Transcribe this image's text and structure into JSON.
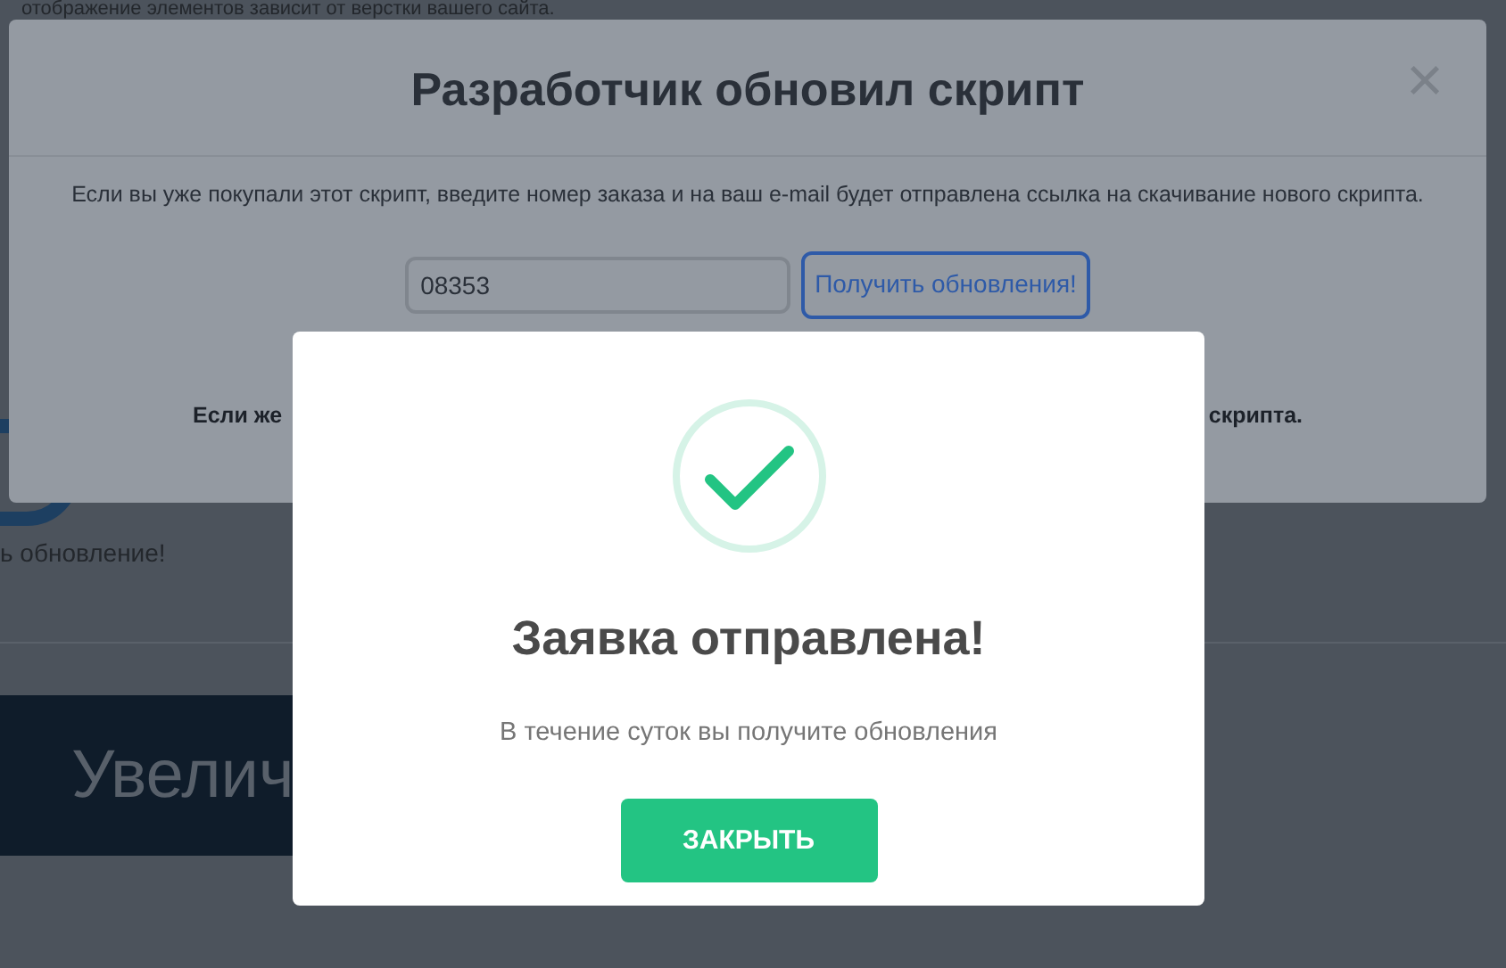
{
  "page": {
    "top_note": "отображение элементов зависит от верстки вашего сайта.",
    "update_note": "ь обновление!",
    "banner_text": "Увелич"
  },
  "update_modal": {
    "title": "Разработчик обновил скрипт",
    "close": "×",
    "description": "Если вы уже покупали этот скрипт, введите номер заказа и на ваш e-mail будет отправлена ссылка на скачивание нового скрипта.",
    "order_field": {
      "value": "08353"
    },
    "submit_button": "Получить обновления!",
    "footer_left": "Если же",
    "footer_right": "скрипта."
  },
  "success_modal": {
    "title": "Заявка отправлена!",
    "message": "В течение суток вы получите обновления",
    "close_button": "ЗАКРЫТЬ"
  }
}
